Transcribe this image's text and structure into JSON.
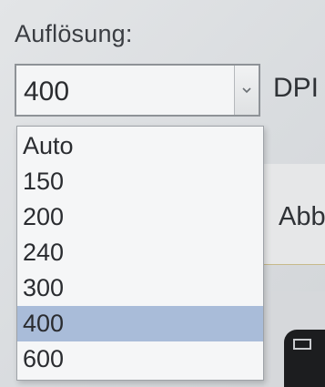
{
  "resolution": {
    "label": "Auflösung:",
    "selected_value": "400",
    "unit": "DPI",
    "dropdown_icon": "chevron-down-icon",
    "options": [
      "Auto",
      "150",
      "200",
      "240",
      "300",
      "400",
      "600"
    ],
    "selected_index": 5,
    "highlight_color": "#a9bcd9"
  },
  "background": {
    "button_label": "Abb"
  }
}
